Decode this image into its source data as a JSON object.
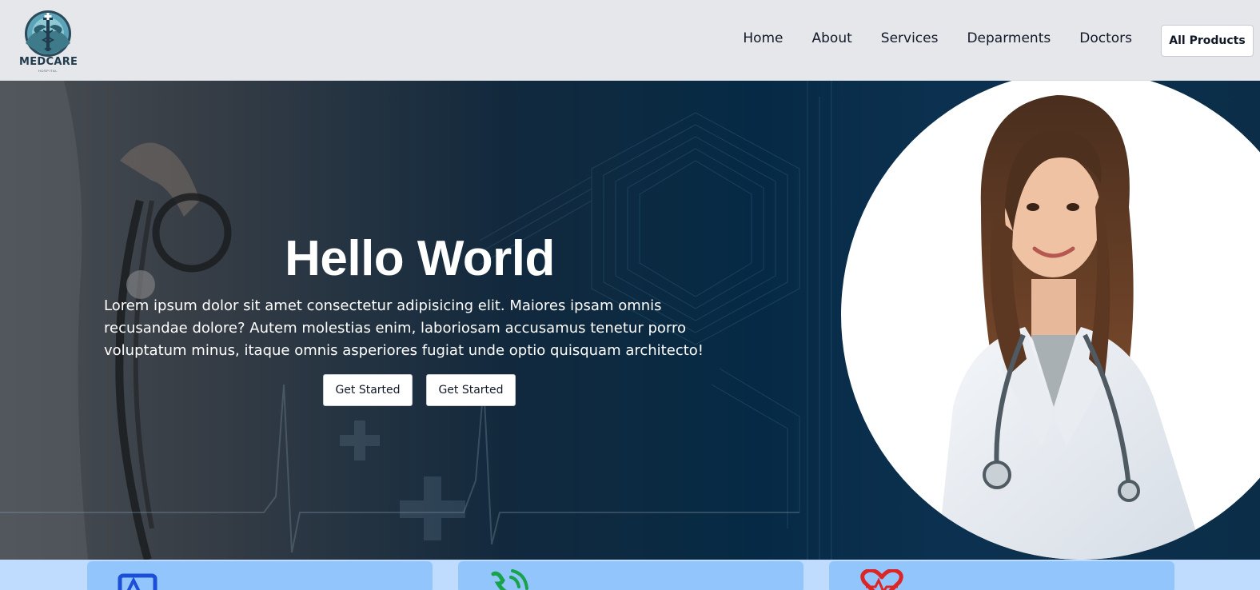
{
  "brand": {
    "name": "MEDCARE",
    "tagline": "HOSPITAL",
    "icon": "caduceus-logo-icon"
  },
  "nav": {
    "items": [
      {
        "label": "Home"
      },
      {
        "label": "About"
      },
      {
        "label": "Services"
      },
      {
        "label": "Deparments"
      },
      {
        "label": "Doctors"
      }
    ],
    "cta_label": "All Products"
  },
  "hero": {
    "title": "Hello World",
    "text": "Lorem ipsum dolor sit amet consectetur adipisicing elit. Maiores ipsam omnis recusandae dolore? Autem molestias enim, laboriosam accusamus tenetur porro voluptatum minus, itaque omnis asperiores fugiat unde optio quisquam architecto!",
    "primary_button": "Get Started",
    "secondary_button": "Get Started",
    "image": "doctor-portrait"
  },
  "feature_cards": [
    {
      "icon": "monitor-pulse-icon",
      "color": "#1d4ed8"
    },
    {
      "icon": "phone-call-icon",
      "color": "#16a34a"
    },
    {
      "icon": "heart-pulse-icon",
      "color": "#dc2626"
    }
  ],
  "colors": {
    "navbar_bg": "#e5e7eb",
    "hero_bg": "#062a45",
    "strip_bg": "#bfdbfe",
    "card_bg": "#93c5fd"
  }
}
